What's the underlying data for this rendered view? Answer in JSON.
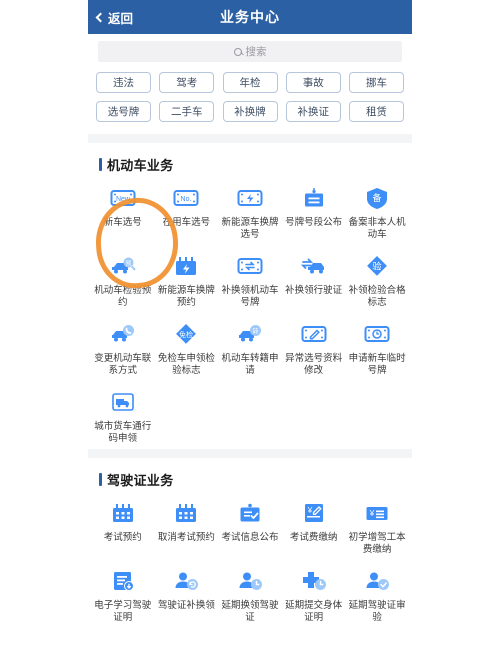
{
  "nav": {
    "back_label": "返回",
    "title": "业务中心",
    "back_icon": "chevron-left-icon",
    "bg_color": "#2C60A5"
  },
  "search": {
    "placeholder": "搜索",
    "icon": "search-icon"
  },
  "chips": {
    "row1": [
      "违法",
      "驾考",
      "年检",
      "事故",
      "挪车"
    ],
    "row2": [
      "选号牌",
      "二手车",
      "补换牌",
      "补换证",
      "租赁"
    ]
  },
  "annotation": {
    "type": "hand-drawn-circle",
    "color": "#F1902F",
    "targets": "新车选号"
  },
  "sections": [
    {
      "title": "机动车业务",
      "items": [
        {
          "label": "新车选号",
          "icon": "plate-new-icon"
        },
        {
          "label": "在用车选号",
          "icon": "plate-no-icon"
        },
        {
          "label": "新能源车换牌选号",
          "icon": "plate-bolt-icon"
        },
        {
          "label": "号牌号段公布",
          "icon": "hanging-board-icon"
        },
        {
          "label": "备案非本人机动车",
          "icon": "shield-bei-icon"
        },
        {
          "label": "机动车检验预约",
          "icon": "car-inspect-booking-icon"
        },
        {
          "label": "新能源车换牌预约",
          "icon": "calendar-bolt-icon"
        },
        {
          "label": "补换领机动车号牌",
          "icon": "plate-swap-icon"
        },
        {
          "label": "补换领行驶证",
          "icon": "car-swap-icon"
        },
        {
          "label": "补领检验合格标志",
          "icon": "diamond-yan-icon"
        },
        {
          "label": "变更机动车联系方式",
          "icon": "car-phone-icon"
        },
        {
          "label": "免检车申领检验标志",
          "icon": "diamond-mianjian-icon"
        },
        {
          "label": "机动车转籍申请",
          "icon": "car-zhuan-icon"
        },
        {
          "label": "异常选号资料修改",
          "icon": "plate-pen-icon"
        },
        {
          "label": "申请新车临时号牌",
          "icon": "plate-clock-icon"
        },
        {
          "label": "城市货车通行码申领",
          "icon": "truck-icon"
        }
      ]
    },
    {
      "title": "驾驶证业务",
      "items": [
        {
          "label": "考试预约",
          "icon": "calendar-icon"
        },
        {
          "label": "取消考试预约",
          "icon": "calendar-icon"
        },
        {
          "label": "考试信息公布",
          "icon": "clipboard-check-icon"
        },
        {
          "label": "考试费缴纳",
          "icon": "yuan-document-pen-icon"
        },
        {
          "label": "初学增驾工本费缴纳",
          "icon": "yuan-card-icon"
        },
        {
          "label": "电子学习驾驶证明",
          "icon": "doc-download-icon"
        },
        {
          "label": "驾驶证补换领",
          "icon": "person-refresh-icon"
        },
        {
          "label": "延期换领驾驶证",
          "icon": "person-clock-icon"
        },
        {
          "label": "延期提交身体证明",
          "icon": "plus-clock-icon"
        },
        {
          "label": "延期驾驶证审验",
          "icon": "person-check-icon"
        }
      ]
    }
  ]
}
